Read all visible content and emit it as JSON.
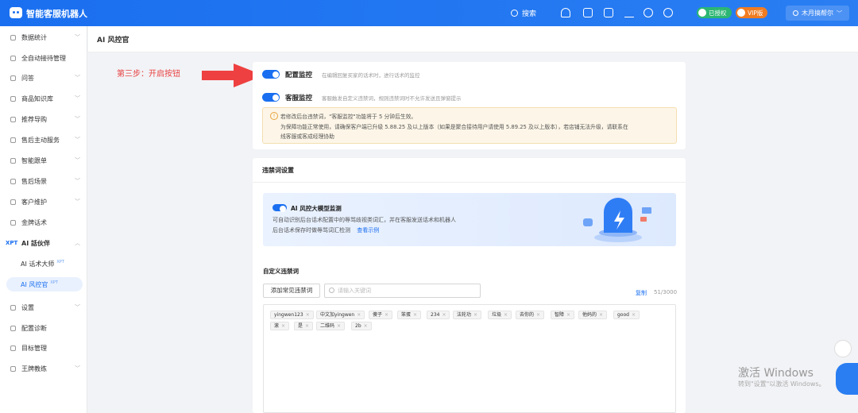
{
  "topbar": {
    "app_title": "智能客服机器人",
    "search_label": "搜索",
    "authorized_label": "已授权",
    "vip_label": "VIP版",
    "user_name": "木月搞帮尔",
    "colors": {
      "bar": "#1a6ff0",
      "authorized": "#2bb673",
      "vip": "#f07c22"
    }
  },
  "sidebar": {
    "items": [
      {
        "label": "数据统计",
        "chevron": "﹀"
      },
      {
        "label": "全自动接待管理",
        "chevron": ""
      },
      {
        "label": "问答",
        "chevron": "﹀"
      },
      {
        "label": "商品知识库",
        "chevron": "﹀"
      },
      {
        "label": "推荐导购",
        "chevron": "﹀"
      },
      {
        "label": "售后主动服务",
        "chevron": "﹀"
      },
      {
        "label": "智能跟单",
        "chevron": "﹀"
      },
      {
        "label": "售后场景",
        "chevron": "﹀"
      },
      {
        "label": "客户维护",
        "chevron": "﹀"
      },
      {
        "label": "金牌话术",
        "chevron": ""
      },
      {
        "label": "AI 話伙伴",
        "chevron": "︿",
        "prefix": "XPT"
      },
      {
        "label": "AI 话术大师",
        "sup": "XPT"
      },
      {
        "label": "AI 风控官",
        "sup": "XPT"
      },
      {
        "label": "设置",
        "chevron": "﹀"
      },
      {
        "label": "配置诊断",
        "chevron": ""
      },
      {
        "label": "目标管理",
        "chevron": ""
      },
      {
        "label": "王牌教练",
        "chevron": "﹀"
      }
    ]
  },
  "page": {
    "title": "AI 风控官"
  },
  "annotation": {
    "text": "第三步：开启按钮",
    "color": "#e84141"
  },
  "settings": {
    "config_monitor_label": "配置监控",
    "config_monitor_desc": "在编辑回复买家的话术时，进行话术的监控",
    "service_monitor_label": "客服监控",
    "service_monitor_desc": "客服触发自定义违禁词，规则违禁词时不允许发送且弹窗提示",
    "notice_lines": [
      "若修改后台违禁词，\"客服监控\"功能将于 5 分钟后生效。",
      "为保障功能正常使用，请确保客户端已升级 5.88.25 及以上版本（如果是聚合接待用户请使用 5.89.25 及以上版本），若店铺无法升级，请联系在",
      "线客服或客成经理协助"
    ]
  },
  "forbidden": {
    "section_title": "违禁词设置",
    "banner_title": "AI 风控大模型监测",
    "banner_line1": "可自动识别后台话术配置中的辱骂歧视类词汇，并在客服发送话术和机器人",
    "banner_line2": "后台话术保存时做辱骂词汇检测",
    "banner_link": "查看示例",
    "custom_title": "自定义违禁词",
    "add_button": "添加常见违禁词",
    "search_placeholder": "请输入关键词",
    "copy_link": "复制",
    "count": "51/3000",
    "tags": [
      "yingwen123",
      "中文加yingwen",
      "傻子",
      "笨蛋",
      "234",
      "法轮功",
      "垃圾",
      "去你的",
      "智障",
      "他妈的",
      "good",
      "滚",
      "是",
      "二维码",
      "2b"
    ]
  },
  "watermark": {
    "line1": "激活 Windows",
    "line2": "转到\"设置\"以激活 Windows。"
  }
}
